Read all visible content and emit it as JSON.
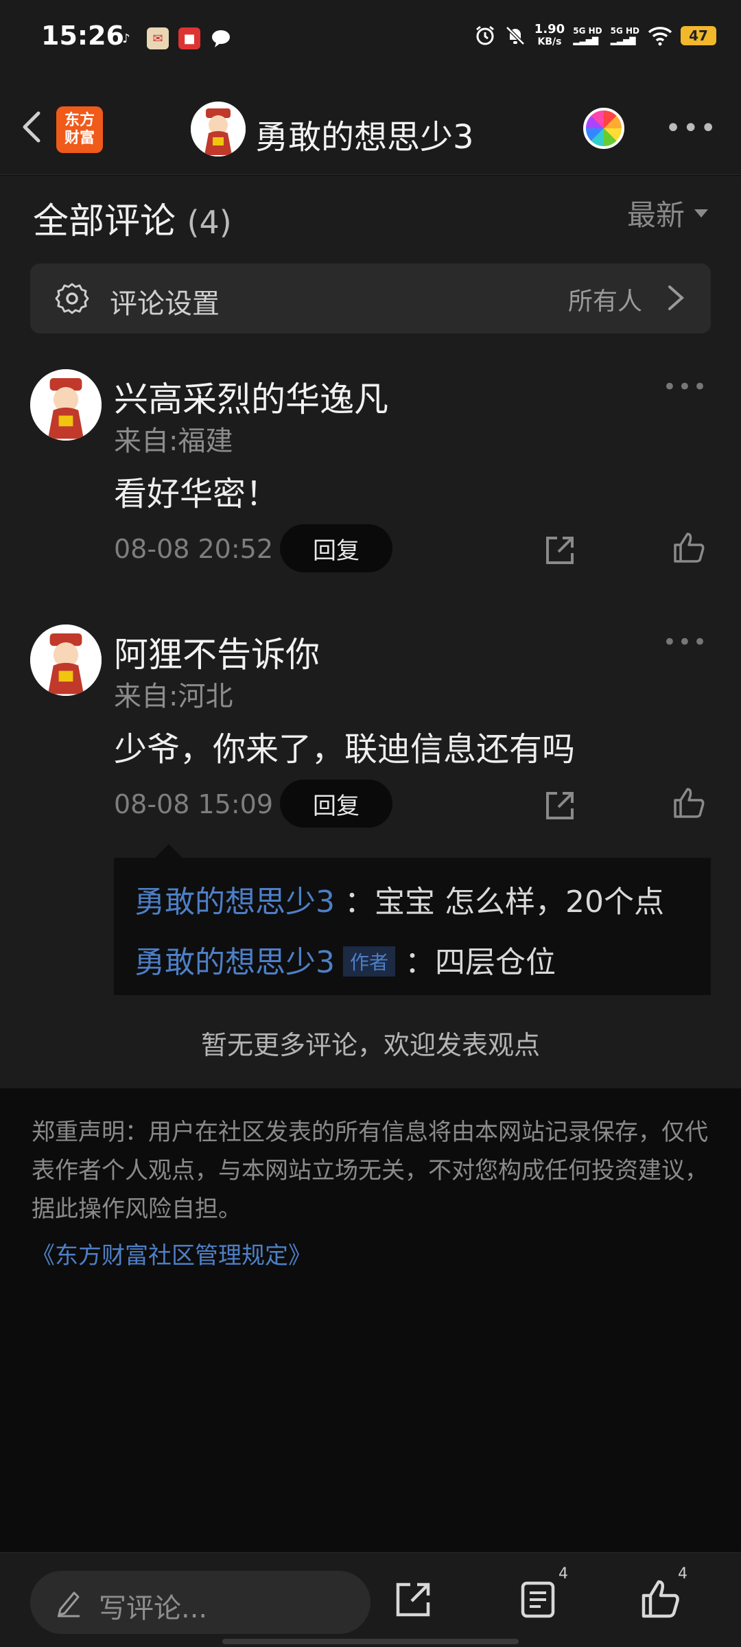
{
  "status_bar": {
    "time": "15:26",
    "net_speed_value": "1.90",
    "net_speed_unit": "KB/s",
    "sim1": "5G HD",
    "sim2": "5G HD",
    "battery": "47"
  },
  "header": {
    "title": "勇敢的想思少3",
    "brand_logo_text": "东方财富"
  },
  "comments_section": {
    "title": "全部评论",
    "count": "(4)",
    "sort_label": "最新",
    "settings": {
      "label": "评论设置",
      "value": "所有人"
    }
  },
  "comments": [
    {
      "username": "兴高采烈的华逸凡",
      "location": "来自:福建",
      "text": "看好华密！",
      "time": "08-08 20:52",
      "reply_label": "回复"
    },
    {
      "username": "阿狸不告诉你",
      "location": "来自:河北",
      "text": "少爷，你来了，联迪信息还有吗",
      "time": "08-08 15:09",
      "reply_label": "回复",
      "replies": [
        {
          "name": "勇敢的想思少3",
          "text": "：宝宝 怎么样，20个点"
        },
        {
          "name": "勇敢的想思少3",
          "tag": "作者",
          "text": "：四层仓位"
        }
      ]
    }
  ],
  "no_more_text": "暂无更多评论，欢迎发表观点",
  "disclaimer": "郑重声明：用户在社区发表的所有信息将由本网站记录保存，仅代表作者个人观点，与本网站立场无关，不对您构成任何投资建议，据此操作风险自担。",
  "rules_link": "《东方财富社区管理规定》",
  "bottom_bar": {
    "input_placeholder": "写评论...",
    "comment_count": "4",
    "like_count": "4"
  },
  "colors": {
    "accent_link": "#4d7fc7",
    "brand_orange": "#f05a1a",
    "battery": "#f2b72b"
  }
}
